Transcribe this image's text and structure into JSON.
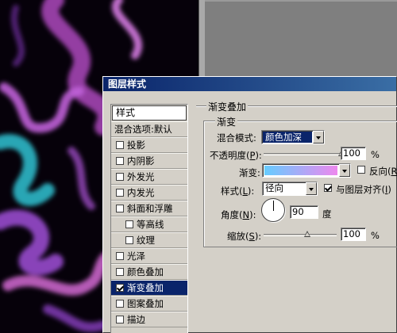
{
  "dialog": {
    "title": "图层样式"
  },
  "styles_list": {
    "header": "样式",
    "items": [
      {
        "label": "混合选项:默认",
        "checkbox": false,
        "checked": false,
        "indent": false,
        "selected": false
      },
      {
        "label": "投影",
        "checkbox": true,
        "checked": false,
        "indent": false,
        "selected": false
      },
      {
        "label": "内阴影",
        "checkbox": true,
        "checked": false,
        "indent": false,
        "selected": false
      },
      {
        "label": "外发光",
        "checkbox": true,
        "checked": false,
        "indent": false,
        "selected": false
      },
      {
        "label": "内发光",
        "checkbox": true,
        "checked": false,
        "indent": false,
        "selected": false
      },
      {
        "label": "斜面和浮雕",
        "checkbox": true,
        "checked": false,
        "indent": false,
        "selected": false
      },
      {
        "label": "等高线",
        "checkbox": true,
        "checked": false,
        "indent": true,
        "selected": false
      },
      {
        "label": "纹理",
        "checkbox": true,
        "checked": false,
        "indent": true,
        "selected": false
      },
      {
        "label": "光泽",
        "checkbox": true,
        "checked": false,
        "indent": false,
        "selected": false
      },
      {
        "label": "颜色叠加",
        "checkbox": true,
        "checked": false,
        "indent": false,
        "selected": false
      },
      {
        "label": "渐变叠加",
        "checkbox": true,
        "checked": true,
        "indent": false,
        "selected": true
      },
      {
        "label": "图案叠加",
        "checkbox": true,
        "checked": false,
        "indent": false,
        "selected": false
      },
      {
        "label": "描边",
        "checkbox": true,
        "checked": false,
        "indent": false,
        "selected": false
      }
    ]
  },
  "panel": {
    "group_title": "渐变叠加",
    "sub_title": "渐变",
    "blend_mode": {
      "label": "混合模式:",
      "value": "颜色加深"
    },
    "opacity": {
      "label_prefix": "不透明度(",
      "hotkey": "P",
      "label_suffix": "):",
      "value": "100",
      "unit": "%",
      "level": 1.0
    },
    "gradient": {
      "label": "渐变:",
      "start_color": "#66ccff",
      "end_color": "#ee88ee",
      "reverse_prefix": "反向(",
      "reverse_hotkey": "R",
      "reverse_suffix": ")",
      "reverse_checked": false
    },
    "style": {
      "label_prefix": "样式(",
      "hotkey": "L",
      "label_suffix": "):",
      "value": "径向",
      "align_label_prefix": "与图层对齐(",
      "align_hotkey": "I",
      "align_label_suffix": ")",
      "align_checked": true
    },
    "angle": {
      "label_prefix": "角度(",
      "hotkey": "N",
      "label_suffix": "):",
      "value": "90",
      "unit": "度"
    },
    "scale": {
      "label_prefix": "缩放(",
      "hotkey": "S",
      "label_suffix": "):",
      "value": "100",
      "unit": "%",
      "level": 0.6
    }
  }
}
